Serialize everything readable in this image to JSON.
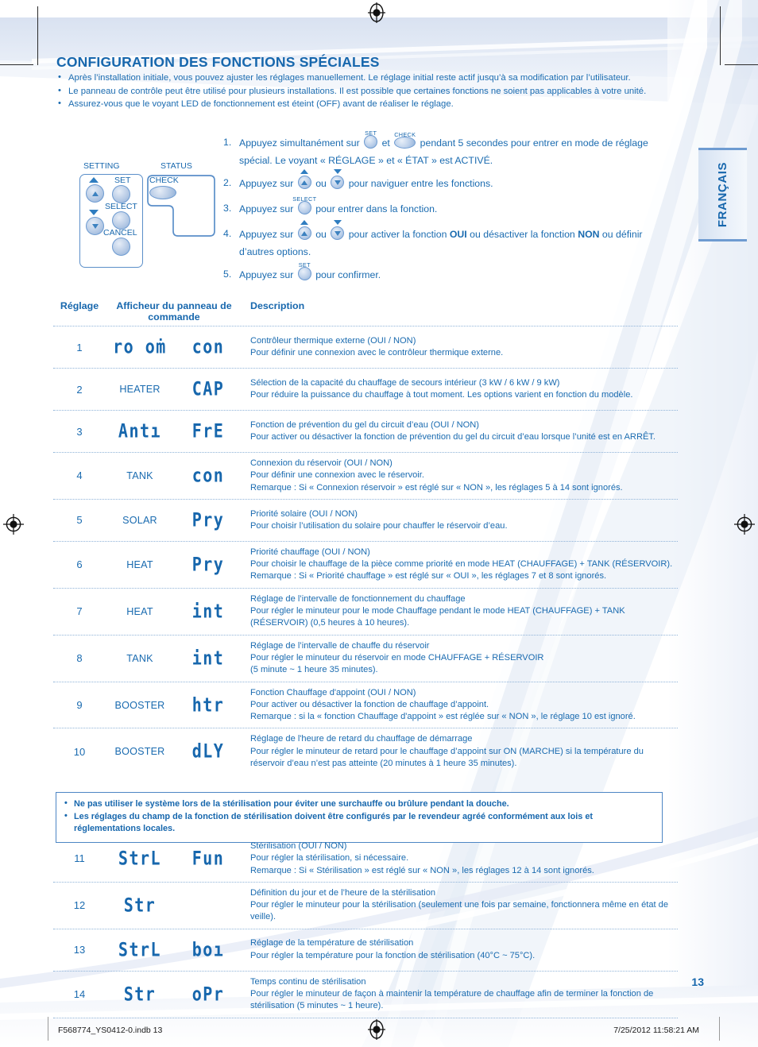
{
  "language_tab": {
    "label": "FRANÇAIS"
  },
  "title": "CONFIGURATION DES FONCTIONS SPÉCIALES",
  "intro_bullets": [
    "Après l’installation initiale, vous pouvez ajuster les réglages manuellement. Le réglage initial reste actif jusqu’à sa modification par l’utilisateur.",
    "Le panneau de contrôle peut être utilisé pour plusieurs installations. Il est possible que certaines fonctions ne soient pas applicables à votre unité.",
    "Assurez-vous que le voyant LED de fonctionnement est éteint (OFF) avant de réaliser le réglage."
  ],
  "panel_figure": {
    "setting_label": "SETTING",
    "status_label": "STATUS",
    "check_label": "CHECK",
    "set_label": "SET",
    "select_label": "SELECT",
    "cancel_label": "CANCEL"
  },
  "steps": [
    {
      "num": "1.",
      "parts": [
        {
          "t": "text",
          "v": "Appuyez simultanément sur "
        },
        {
          "t": "btn-round",
          "cap": "SET"
        },
        {
          "t": "text",
          "v": " et "
        },
        {
          "t": "btn-oval",
          "cap": "CHECK"
        },
        {
          "t": "text",
          "v": " pendant 5 secondes pour entrer en mode de réglage spécial. Le voyant « RÉGLAGE » et « ÉTAT » est ACTIVÉ."
        }
      ]
    },
    {
      "num": "2.",
      "parts": [
        {
          "t": "text",
          "v": "Appuyez sur "
        },
        {
          "t": "btn-up",
          "cap": ""
        },
        {
          "t": "text",
          "v": " ou "
        },
        {
          "t": "btn-dn",
          "cap": ""
        },
        {
          "t": "text",
          "v": " pour naviguer entre les fonctions."
        }
      ]
    },
    {
      "num": "3.",
      "parts": [
        {
          "t": "text",
          "v": "Appuyez sur "
        },
        {
          "t": "btn-round",
          "cap": "SELECT"
        },
        {
          "t": "text",
          "v": "  pour entrer dans la fonction."
        }
      ]
    },
    {
      "num": "4.",
      "parts": [
        {
          "t": "text",
          "v": "Appuyez sur "
        },
        {
          "t": "btn-up",
          "cap": ""
        },
        {
          "t": "text",
          "v": " ou "
        },
        {
          "t": "btn-dn",
          "cap": ""
        },
        {
          "t": "text",
          "v": " pour activer la fonction "
        },
        {
          "t": "bold",
          "v": "OUI"
        },
        {
          "t": "text",
          "v": " ou désactiver la fonction "
        },
        {
          "t": "bold",
          "v": "NON"
        },
        {
          "t": "text",
          "v": " ou définir d’autres options."
        }
      ]
    },
    {
      "num": "5.",
      "parts": [
        {
          "t": "text",
          "v": "Appuyez sur "
        },
        {
          "t": "btn-round",
          "cap": "SET"
        },
        {
          "t": "text",
          "v": " pour confirmer."
        }
      ]
    }
  ],
  "table": {
    "headers": {
      "setting": "Réglage",
      "display": "Afficheur du panneau de commande",
      "description": "Description"
    },
    "rows_part1": [
      {
        "setting": "1",
        "display_left": "ro oṁ",
        "display_left_kind": "lcd",
        "display_right": "con",
        "display_right_kind": "lcd",
        "description": [
          "Contrôleur thermique externe (OUI / NON)",
          "Pour définir une connexion avec le contrôleur thermique externe."
        ]
      },
      {
        "setting": "2",
        "display_left": "HEATER",
        "display_left_kind": "plain",
        "display_right": "CAP",
        "display_right_kind": "lcd",
        "description": [
          "Sélection de la capacité du chauffage de secours intérieur (3 kW / 6 kW / 9 kW)",
          "Pour réduire la puissance du chauffage à tout moment. Les options varient en fonction du modèle."
        ]
      },
      {
        "setting": "3",
        "display_left": "Antı",
        "display_left_kind": "lcd",
        "display_right": "FrE",
        "display_right_kind": "lcd",
        "description": [
          "Fonction de prévention du gel du circuit d’eau (OUI / NON)",
          "Pour activer ou désactiver la fonction de prévention du gel du circuit d’eau lorsque l’unité est en ARRÊT."
        ]
      },
      {
        "setting": "4",
        "display_left": "TANK",
        "display_left_kind": "plain",
        "display_right": "con",
        "display_right_kind": "lcd",
        "description": [
          "Connexion du réservoir (OUI / NON)",
          "Pour définir une connexion avec le réservoir.",
          "Remarque : Si « Connexion réservoir » est réglé sur « NON », les réglages 5 à 14 sont ignorés."
        ]
      },
      {
        "setting": "5",
        "display_left": "SOLAR",
        "display_left_kind": "plain",
        "display_right": "Pry",
        "display_right_kind": "lcd",
        "description": [
          "Priorité solaire (OUI / NON)",
          "Pour choisir l’utilisation du solaire pour chauffer le réservoir d’eau."
        ]
      },
      {
        "setting": "6",
        "display_left": "HEAT",
        "display_left_kind": "plain",
        "display_right": "Pry",
        "display_right_kind": "lcd",
        "description": [
          "Priorité chauffage (OUI / NON)",
          "Pour choisir le chauffage de la pièce comme priorité en mode HEAT (CHAUFFAGE) + TANK (RÉSERVOIR).",
          "Remarque : Si « Priorité chauffage » est réglé sur « OUI », les réglages 7 et 8 sont ignorés."
        ]
      },
      {
        "setting": "7",
        "display_left": "HEAT",
        "display_left_kind": "plain",
        "display_right": "int",
        "display_right_kind": "lcd",
        "description": [
          "Réglage de l’intervalle de fonctionnement du chauffage",
          "Pour régler le minuteur pour le mode Chauffage pendant le mode HEAT (CHAUFFAGE) + TANK (RÉSERVOIR) (0,5 heures à 10 heures)."
        ]
      },
      {
        "setting": "8",
        "display_left": "TANK",
        "display_left_kind": "plain",
        "display_right": "int",
        "display_right_kind": "lcd",
        "description": [
          "Réglage de l’intervalle de chauffe du réservoir",
          "Pour régler le minuteur du réservoir en mode CHAUFFAGE + RÉSERVOIR",
          "(5 minute ~ 1 heure 35 minutes)."
        ]
      },
      {
        "setting": "9",
        "display_left": "BOOSTER",
        "display_left_kind": "plain",
        "display_right": "htr",
        "display_right_kind": "lcd",
        "description": [
          "Fonction Chauffage d'appoint (OUI / NON)",
          "Pour activer ou désactiver la fonction de chauffage d’appoint.",
          "Remarque : si la « fonction Chauffage d'appoint » est réglée sur « NON », le réglage 10 est ignoré."
        ]
      },
      {
        "setting": "10",
        "display_left": "BOOSTER",
        "display_left_kind": "plain",
        "display_right": "dLY",
        "display_right_kind": "lcd",
        "description": [
          "Réglage de l'heure de retard du chauffage de démarrage",
          "Pour régler le minuteur de retard pour le chauffage d’appoint sur ON (MARCHE) si la température du réservoir d’eau n’est pas atteinte (20 minutes à 1 heure 35 minutes)."
        ]
      }
    ],
    "warning_bullets": [
      "Ne pas utiliser le système lors de la stérilisation pour éviter une surchauffe ou brûlure pendant la douche.",
      "Les réglages du champ de la fonction de stérilisation doivent être configurés par le revendeur agréé conformément aux lois et réglementations locales."
    ],
    "rows_part2": [
      {
        "setting": "11",
        "display_left": "StrL",
        "display_left_kind": "lcd",
        "display_right": "Fun",
        "display_right_kind": "lcd",
        "description": [
          "Stérilisation (OUI / NON)",
          "Pour régler la stérilisation, si nécessaire.",
          "Remarque : Si « Stérilisation » est réglé sur « NON », les réglages 12 à 14 sont ignorés."
        ]
      },
      {
        "setting": "12",
        "display_left": "Str",
        "display_left_kind": "lcd",
        "display_right": "",
        "display_right_kind": "lcd",
        "description": [
          "Définition du jour et de l’heure de la stérilisation",
          "Pour régler le minuteur pour la stérilisation (seulement une fois par semaine, fonctionnera même en état de veille)."
        ]
      },
      {
        "setting": "13",
        "display_left": "StrL",
        "display_left_kind": "lcd",
        "display_right": "boı",
        "display_right_kind": "lcd",
        "description": [
          "Réglage de la température de stérilisation",
          "Pour régler la température pour la fonction de stérilisation (40°C ~ 75°C)."
        ]
      },
      {
        "setting": "14",
        "display_left": "Str",
        "display_left_kind": "lcd",
        "display_right": "oPr",
        "display_right_kind": "lcd",
        "description": [
          "Temps continu de stérilisation",
          "Pour régler le minuteur de façon à maintenir la température de chauffage afin de terminer la fonction de stérilisation (5 minutes ~ 1 heure)."
        ]
      }
    ]
  },
  "page_number": "13",
  "footer": {
    "left": "F568774_YS0412-0.indb   13",
    "right": "7/25/2012   11:58:21 AM"
  },
  "colors": {
    "primary_blue": "#1767ad",
    "body_blue": "#1a6bb0",
    "rule_blue": "#8fb3d8",
    "panel_border": "#5b8fc9",
    "tab_bg": "#d6e2f2"
  }
}
